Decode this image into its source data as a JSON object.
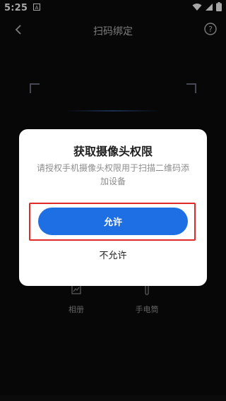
{
  "status_bar": {
    "time": "5:25",
    "notification_icon": "a-box-icon",
    "wifi_icon": "wifi-icon",
    "signal_icon": "signal-icon",
    "battery_icon": "battery-icon"
  },
  "nav": {
    "title": "扫码绑定",
    "back_icon": "chevron-left-icon",
    "help_icon": "question-circle-icon"
  },
  "tools": {
    "album_label": "相册",
    "flashlight_label": "手电筒"
  },
  "dialog": {
    "title": "获取摄像头权限",
    "message": "请授权手机摄像头权限用于扫描二维码添加设备",
    "allow_label": "允许",
    "deny_label": "不允许",
    "highlight_color": "#e02a2a",
    "accent_color": "#1f6fe4"
  }
}
